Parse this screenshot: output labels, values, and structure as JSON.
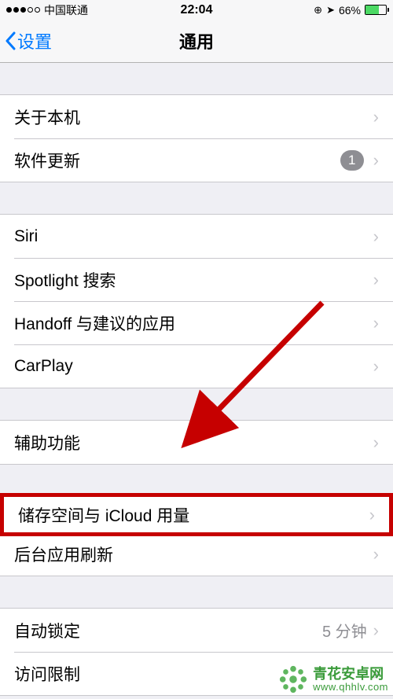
{
  "status": {
    "carrier": "中国联通",
    "time": "22:04",
    "battery_pct": "66%"
  },
  "nav": {
    "back_label": "设置",
    "title": "通用"
  },
  "groups": [
    {
      "cells": [
        {
          "label": "关于本机",
          "badge": null,
          "detail": null
        },
        {
          "label": "软件更新",
          "badge": "1",
          "detail": null
        }
      ]
    },
    {
      "cells": [
        {
          "label": "Siri",
          "badge": null,
          "detail": null
        },
        {
          "label": "Spotlight 搜索",
          "badge": null,
          "detail": null
        },
        {
          "label": "Handoff 与建议的应用",
          "badge": null,
          "detail": null
        },
        {
          "label": "CarPlay",
          "badge": null,
          "detail": null
        }
      ]
    },
    {
      "cells": [
        {
          "label": "辅助功能",
          "badge": null,
          "detail": null
        }
      ]
    },
    {
      "cells": [
        {
          "label": "储存空间与 iCloud 用量",
          "badge": null,
          "detail": null,
          "highlighted": true
        },
        {
          "label": "后台应用刷新",
          "badge": null,
          "detail": null
        }
      ]
    },
    {
      "cells": [
        {
          "label": "自动锁定",
          "badge": null,
          "detail": "5 分钟"
        },
        {
          "label": "访问限制",
          "badge": null,
          "detail": null
        }
      ]
    }
  ],
  "annotation": {
    "arrow_color": "#c60000",
    "highlight_color": "#c60000"
  },
  "watermark": {
    "name": "青花安卓网",
    "url": "www.qhhlv.com"
  }
}
